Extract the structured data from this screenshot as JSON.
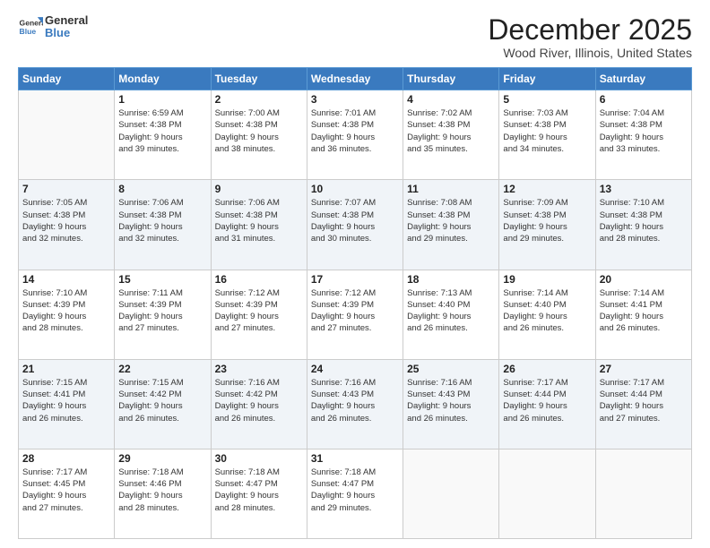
{
  "logo": {
    "general": "General",
    "blue": "Blue"
  },
  "header": {
    "title": "December 2025",
    "subtitle": "Wood River, Illinois, United States"
  },
  "days_of_week": [
    "Sunday",
    "Monday",
    "Tuesday",
    "Wednesday",
    "Thursday",
    "Friday",
    "Saturday"
  ],
  "weeks": [
    [
      {
        "day": "",
        "empty": true
      },
      {
        "day": "1",
        "sunrise": "6:59 AM",
        "sunset": "4:38 PM",
        "daylight": "9 hours and 39 minutes."
      },
      {
        "day": "2",
        "sunrise": "7:00 AM",
        "sunset": "4:38 PM",
        "daylight": "9 hours and 38 minutes."
      },
      {
        "day": "3",
        "sunrise": "7:01 AM",
        "sunset": "4:38 PM",
        "daylight": "9 hours and 36 minutes."
      },
      {
        "day": "4",
        "sunrise": "7:02 AM",
        "sunset": "4:38 PM",
        "daylight": "9 hours and 35 minutes."
      },
      {
        "day": "5",
        "sunrise": "7:03 AM",
        "sunset": "4:38 PM",
        "daylight": "9 hours and 34 minutes."
      },
      {
        "day": "6",
        "sunrise": "7:04 AM",
        "sunset": "4:38 PM",
        "daylight": "9 hours and 33 minutes."
      }
    ],
    [
      {
        "day": "7",
        "sunrise": "7:05 AM",
        "sunset": "4:38 PM",
        "daylight": "9 hours and 32 minutes."
      },
      {
        "day": "8",
        "sunrise": "7:06 AM",
        "sunset": "4:38 PM",
        "daylight": "9 hours and 32 minutes."
      },
      {
        "day": "9",
        "sunrise": "7:06 AM",
        "sunset": "4:38 PM",
        "daylight": "9 hours and 31 minutes."
      },
      {
        "day": "10",
        "sunrise": "7:07 AM",
        "sunset": "4:38 PM",
        "daylight": "9 hours and 30 minutes."
      },
      {
        "day": "11",
        "sunrise": "7:08 AM",
        "sunset": "4:38 PM",
        "daylight": "9 hours and 29 minutes."
      },
      {
        "day": "12",
        "sunrise": "7:09 AM",
        "sunset": "4:38 PM",
        "daylight": "9 hours and 29 minutes."
      },
      {
        "day": "13",
        "sunrise": "7:10 AM",
        "sunset": "4:38 PM",
        "daylight": "9 hours and 28 minutes."
      }
    ],
    [
      {
        "day": "14",
        "sunrise": "7:10 AM",
        "sunset": "4:39 PM",
        "daylight": "9 hours and 28 minutes."
      },
      {
        "day": "15",
        "sunrise": "7:11 AM",
        "sunset": "4:39 PM",
        "daylight": "9 hours and 27 minutes."
      },
      {
        "day": "16",
        "sunrise": "7:12 AM",
        "sunset": "4:39 PM",
        "daylight": "9 hours and 27 minutes."
      },
      {
        "day": "17",
        "sunrise": "7:12 AM",
        "sunset": "4:39 PM",
        "daylight": "9 hours and 27 minutes."
      },
      {
        "day": "18",
        "sunrise": "7:13 AM",
        "sunset": "4:40 PM",
        "daylight": "9 hours and 26 minutes."
      },
      {
        "day": "19",
        "sunrise": "7:14 AM",
        "sunset": "4:40 PM",
        "daylight": "9 hours and 26 minutes."
      },
      {
        "day": "20",
        "sunrise": "7:14 AM",
        "sunset": "4:41 PM",
        "daylight": "9 hours and 26 minutes."
      }
    ],
    [
      {
        "day": "21",
        "sunrise": "7:15 AM",
        "sunset": "4:41 PM",
        "daylight": "9 hours and 26 minutes."
      },
      {
        "day": "22",
        "sunrise": "7:15 AM",
        "sunset": "4:42 PM",
        "daylight": "9 hours and 26 minutes."
      },
      {
        "day": "23",
        "sunrise": "7:16 AM",
        "sunset": "4:42 PM",
        "daylight": "9 hours and 26 minutes."
      },
      {
        "day": "24",
        "sunrise": "7:16 AM",
        "sunset": "4:43 PM",
        "daylight": "9 hours and 26 minutes."
      },
      {
        "day": "25",
        "sunrise": "7:16 AM",
        "sunset": "4:43 PM",
        "daylight": "9 hours and 26 minutes."
      },
      {
        "day": "26",
        "sunrise": "7:17 AM",
        "sunset": "4:44 PM",
        "daylight": "9 hours and 26 minutes."
      },
      {
        "day": "27",
        "sunrise": "7:17 AM",
        "sunset": "4:44 PM",
        "daylight": "9 hours and 27 minutes."
      }
    ],
    [
      {
        "day": "28",
        "sunrise": "7:17 AM",
        "sunset": "4:45 PM",
        "daylight": "9 hours and 27 minutes."
      },
      {
        "day": "29",
        "sunrise": "7:18 AM",
        "sunset": "4:46 PM",
        "daylight": "9 hours and 28 minutes."
      },
      {
        "day": "30",
        "sunrise": "7:18 AM",
        "sunset": "4:47 PM",
        "daylight": "9 hours and 28 minutes."
      },
      {
        "day": "31",
        "sunrise": "7:18 AM",
        "sunset": "4:47 PM",
        "daylight": "9 hours and 29 minutes."
      },
      {
        "day": "",
        "empty": true
      },
      {
        "day": "",
        "empty": true
      },
      {
        "day": "",
        "empty": true
      }
    ]
  ],
  "labels": {
    "sunrise_prefix": "Sunrise: ",
    "sunset_prefix": "Sunset: ",
    "daylight_prefix": "Daylight: "
  }
}
